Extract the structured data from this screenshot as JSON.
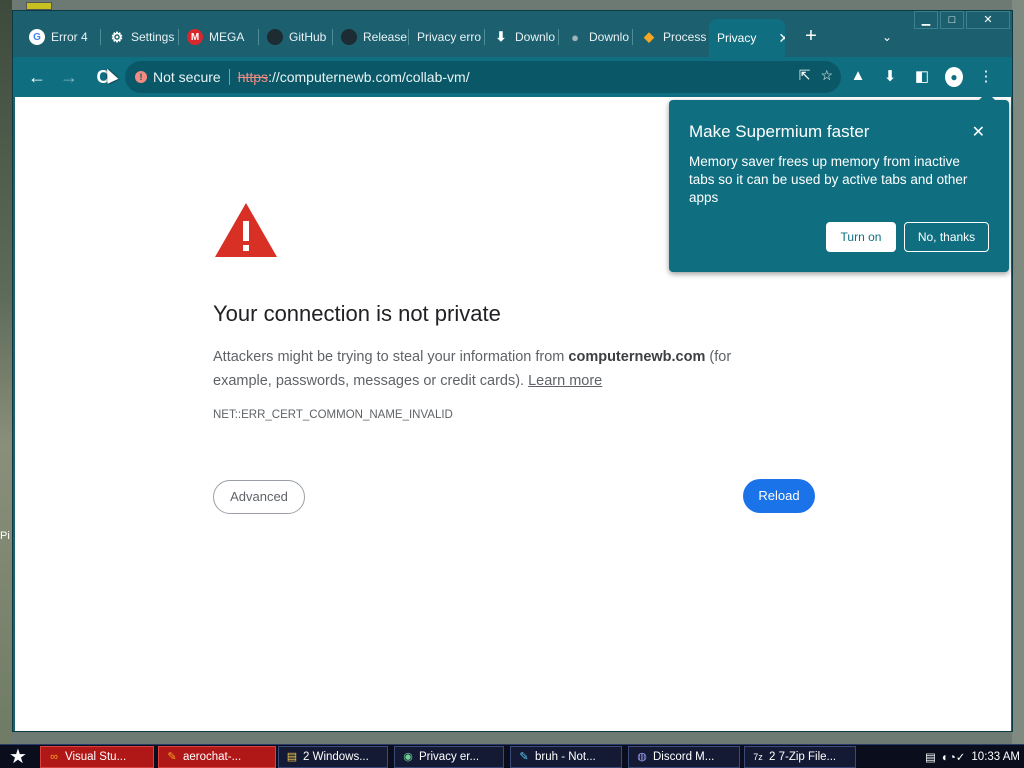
{
  "browser": {
    "tabs": [
      {
        "label": "Error 4",
        "icon": "G"
      },
      {
        "label": "Settings",
        "icon": "⚙"
      },
      {
        "label": "MEGA",
        "icon": "M"
      },
      {
        "label": "GitHub",
        "icon": ""
      },
      {
        "label": "Release",
        "icon": ""
      },
      {
        "label": "Privacy erro",
        "icon": ""
      },
      {
        "label": "Downlo",
        "icon": "⬇"
      },
      {
        "label": "Downlo",
        "icon": "●"
      },
      {
        "label": "Process",
        "icon": "◆"
      },
      {
        "label": "Privacy",
        "icon": ""
      }
    ],
    "active_tab_close": "✕",
    "new_tab": "+",
    "tab_search": "⌄",
    "window_controls": {
      "minimize": "▁",
      "maximize": "□",
      "close": "✕"
    },
    "nav": {
      "back": "←",
      "forward": "→",
      "reload": "C"
    },
    "omnibox": {
      "security_label": "Not secure",
      "url_scheme": "https",
      "url_rest": "://computernewb.com/collab-vm/"
    },
    "toolbar_icons": {
      "share": "⇱",
      "bookmark": "☆",
      "labs": "▲",
      "download": "⬇",
      "sidepanel": "◧",
      "profile": "●",
      "menu": "⋮"
    }
  },
  "error_page": {
    "title": "Your connection is not private",
    "desc_prefix": "Attackers might be trying to steal your information from ",
    "domain": "computernewb.com",
    "desc_suffix": " (for example, passwords, messages or credit cards). ",
    "learn_more": "Learn more",
    "error_code": "NET::ERR_CERT_COMMON_NAME_INVALID",
    "advanced_label": "Advanced",
    "reload_label": "Reload",
    "warning_color": "#d93025"
  },
  "popup": {
    "title": "Make Supermium faster",
    "body": "Memory saver frees up memory from inactive tabs so it can be used by active tabs and other apps",
    "turn_on": "Turn on",
    "no_thanks": "No, thanks",
    "close": "✕"
  },
  "taskbar": {
    "start": "★",
    "items": [
      {
        "label": "Visual Stu...",
        "icon": "∞"
      },
      {
        "label": "aerochat-...",
        "icon": "✎"
      },
      {
        "label": "2 Windows...",
        "icon": "▤"
      },
      {
        "label": "Privacy er...",
        "icon": "◉"
      },
      {
        "label": "bruh - Not...",
        "icon": "✎"
      },
      {
        "label": "Discord M...",
        "icon": "◍"
      },
      {
        "label": "2 7-Zip File...",
        "icon": "7z"
      }
    ],
    "clock": "10:33 AM"
  },
  "desktop": {
    "side_text": "Pi"
  }
}
